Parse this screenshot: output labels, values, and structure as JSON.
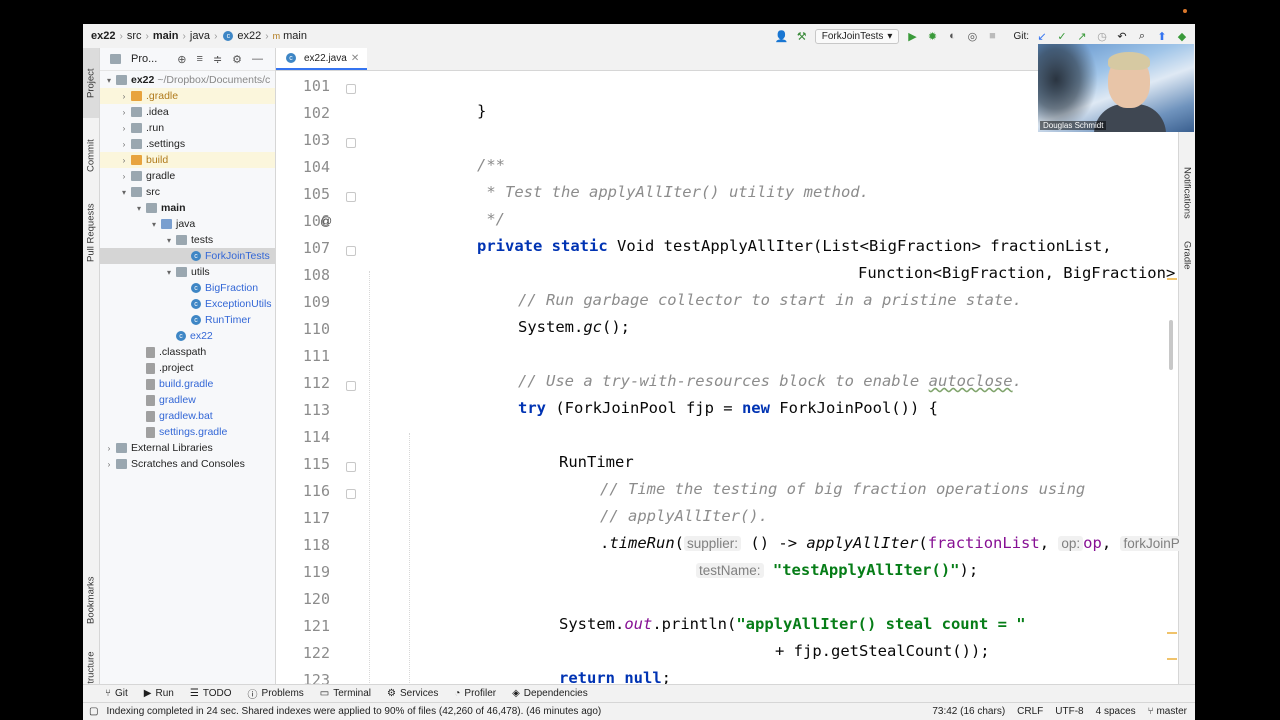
{
  "breadcrumb": [
    "ex22",
    "src",
    "main",
    "java",
    "ex22",
    "main"
  ],
  "toolbar": {
    "run_config": "ForkJoinTests",
    "git_label": "Git:"
  },
  "left_tabs": [
    "Project",
    "Commit",
    "Pull Requests",
    "Bookmarks",
    "Structure"
  ],
  "right_tabs": [
    "Notifications",
    "Gradle"
  ],
  "project_panel": {
    "title": "Pro..."
  },
  "tree": [
    {
      "label": "ex22",
      "suffix": "~/Dropbox/Documents/c",
      "depth": 0,
      "expanded": true,
      "icon": "folder"
    },
    {
      "label": ".gradle",
      "depth": 1,
      "icon": "folder-orange",
      "style": "orange"
    },
    {
      "label": ".idea",
      "depth": 1,
      "icon": "folder"
    },
    {
      "label": ".run",
      "depth": 1,
      "icon": "folder"
    },
    {
      "label": ".settings",
      "depth": 1,
      "icon": "folder"
    },
    {
      "label": "build",
      "depth": 1,
      "icon": "folder-orange",
      "style": "orange"
    },
    {
      "label": "gradle",
      "depth": 1,
      "icon": "folder"
    },
    {
      "label": "src",
      "depth": 1,
      "expanded": true,
      "icon": "folder"
    },
    {
      "label": "main",
      "depth": 2,
      "expanded": true,
      "icon": "folder"
    },
    {
      "label": "java",
      "depth": 3,
      "expanded": true,
      "icon": "folder-blue"
    },
    {
      "label": "tests",
      "depth": 4,
      "expanded": true,
      "icon": "folder"
    },
    {
      "label": "ForkJoinTests",
      "depth": 5,
      "icon": "class",
      "style": "blue",
      "selected": true
    },
    {
      "label": "utils",
      "depth": 4,
      "expanded": true,
      "icon": "folder"
    },
    {
      "label": "BigFraction",
      "depth": 5,
      "icon": "class",
      "style": "blue"
    },
    {
      "label": "ExceptionUtils",
      "depth": 5,
      "icon": "class",
      "style": "blue"
    },
    {
      "label": "RunTimer",
      "depth": 5,
      "icon": "class",
      "style": "blue"
    },
    {
      "label": "ex22",
      "depth": 4,
      "icon": "class",
      "style": "blue"
    },
    {
      "label": ".classpath",
      "depth": 2,
      "icon": "file"
    },
    {
      "label": ".project",
      "depth": 2,
      "icon": "file"
    },
    {
      "label": "build.gradle",
      "depth": 2,
      "icon": "file",
      "style": "blue"
    },
    {
      "label": "gradlew",
      "depth": 2,
      "icon": "file",
      "style": "blue"
    },
    {
      "label": "gradlew.bat",
      "depth": 2,
      "icon": "file",
      "style": "blue"
    },
    {
      "label": "settings.gradle",
      "depth": 2,
      "icon": "file",
      "style": "blue"
    },
    {
      "label": "External Libraries",
      "depth": 0,
      "icon": "folder"
    },
    {
      "label": "Scratches and Consoles",
      "depth": 0,
      "icon": "folder"
    }
  ],
  "editor_tab": "ex22.java",
  "line_numbers": [
    "101",
    "102",
    "103",
    "104",
    "105",
    "106",
    "107",
    "108",
    "109",
    "110",
    "111",
    "112",
    "113",
    "114",
    "115",
    "116",
    "117",
    "118",
    "119",
    "120",
    "121",
    "122",
    "123"
  ],
  "code": {
    "l101": "}",
    "l103": "/**",
    "l104": " * Test the applyAllIter() utility method.",
    "l105": " */",
    "l106_kw1": "private",
    "l106_kw2": "static",
    "l106_rest": "Void testApplyAllIter(List<BigFraction> fractionList,",
    "l107": "Function<BigFraction, BigFraction> op)",
    "l108": "// Run garbage collector to start in a pristine state.",
    "l109_a": "System.",
    "l109_b": "gc",
    "l109_c": "();",
    "l111_a": "// Use a try-with-resources block to enable ",
    "l111_b": "autoclose",
    "l111_c": ".",
    "l112_kw": "try",
    "l112_a": " (ForkJoinPool fjp = ",
    "l112_kw2": "new",
    "l112_b": " ForkJoinPool()) {",
    "l114": "RunTimer",
    "l115": "// Time the testing of big fraction operations using",
    "l116": "// applyAllIter().",
    "l117_a": ".",
    "l117_b": "timeRun",
    "l117_c": "(",
    "l117_hint1": "supplier:",
    "l117_d": " () -> ",
    "l117_e": "applyAllIter",
    "l117_f": "(",
    "l117_g": "fractionList",
    "l117_h": ", ",
    "l117_hint2": "op:",
    "l117_i": "op",
    "l117_j": ", ",
    "l117_hint3": "forkJoinPo",
    "l118_hint": "testName:",
    "l118_str": "\"testApplyAllIter()\"",
    "l118_end": ");",
    "l120_a": "System.",
    "l120_b": "out",
    "l120_c": ".println(",
    "l120_str": "\"applyAllIter() steal count = \"",
    "l121": "+ fjp.getStealCount());",
    "l122_kw": "return",
    "l122_kw2": "null",
    "l122_end": ";",
    "l123": "}"
  },
  "bottom_tools": [
    "Git",
    "Run",
    "TODO",
    "Problems",
    "Terminal",
    "Services",
    "Profiler",
    "Dependencies"
  ],
  "status": {
    "message": "Indexing completed in 24 sec. Shared indexes were applied to 90% of files (42,260 of 46,478). (46 minutes ago)",
    "position": "73:42 (16 chars)",
    "line_sep": "CRLF",
    "encoding": "UTF-8",
    "indent": "4 spaces",
    "branch": "master"
  },
  "webcam": {
    "name": "Douglas Schmidt"
  }
}
